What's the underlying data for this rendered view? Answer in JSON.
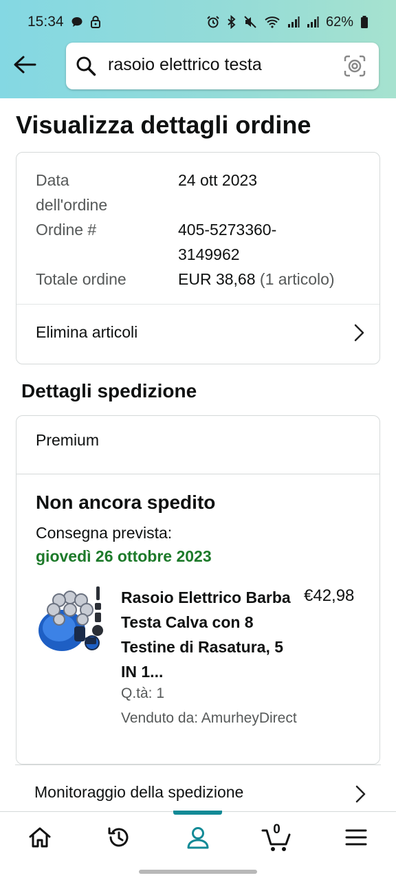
{
  "status_bar": {
    "time": "15:34",
    "battery": "62%",
    "icons_left": [
      "chat-bubble-icon",
      "lock-icon"
    ],
    "icons_right": [
      "alarm-icon",
      "bluetooth-icon",
      "mute-icon",
      "wifi-icon",
      "signal-icon",
      "signal-icon",
      "battery-icon"
    ]
  },
  "header": {
    "back_icon": "arrow-left-icon",
    "search_value": "rasoio elettrico testa",
    "search_icon": "search-icon",
    "camera_icon": "camera-lens-icon"
  },
  "page": {
    "title": "Visualizza dettagli ordine"
  },
  "order": {
    "date_label_1": "Data",
    "date_label_2": "dell'ordine",
    "date_value": "24 ott 2023",
    "number_label": "Ordine #",
    "number_value_1": "405-5273360-",
    "number_value_2": "3149962",
    "total_label": "Totale ordine",
    "total_value": "EUR 38,68",
    "total_items": "(1 articolo)",
    "remove_items": "Elimina articoli"
  },
  "shipping": {
    "section_title": "Dettagli spedizione",
    "service": "Premium",
    "status": "Non ancora spedito",
    "delivery_label": "Consegna prevista:",
    "delivery_date": "giovedì 26 ottobre 2023",
    "product": {
      "title": "Rasoio Elettrico Barba Testa Calva con 8 Testine di Rasatura, 5 IN 1...",
      "price": "€42,98",
      "qty": "Q.tà: 1",
      "seller": "Venduto da: AmurheyDirect"
    },
    "tracking": "Monitoraggio della spedizione"
  },
  "bottom_nav": {
    "items": [
      "home-icon",
      "history-icon",
      "account-icon",
      "cart-icon",
      "menu-icon"
    ],
    "cart_count": "0",
    "active": "account-icon"
  },
  "colors": {
    "accent": "#128a96",
    "delivery_green": "#1d7a2a",
    "header_gradient_start": "#84d8e3",
    "header_gradient_end": "#a6e2cf"
  }
}
